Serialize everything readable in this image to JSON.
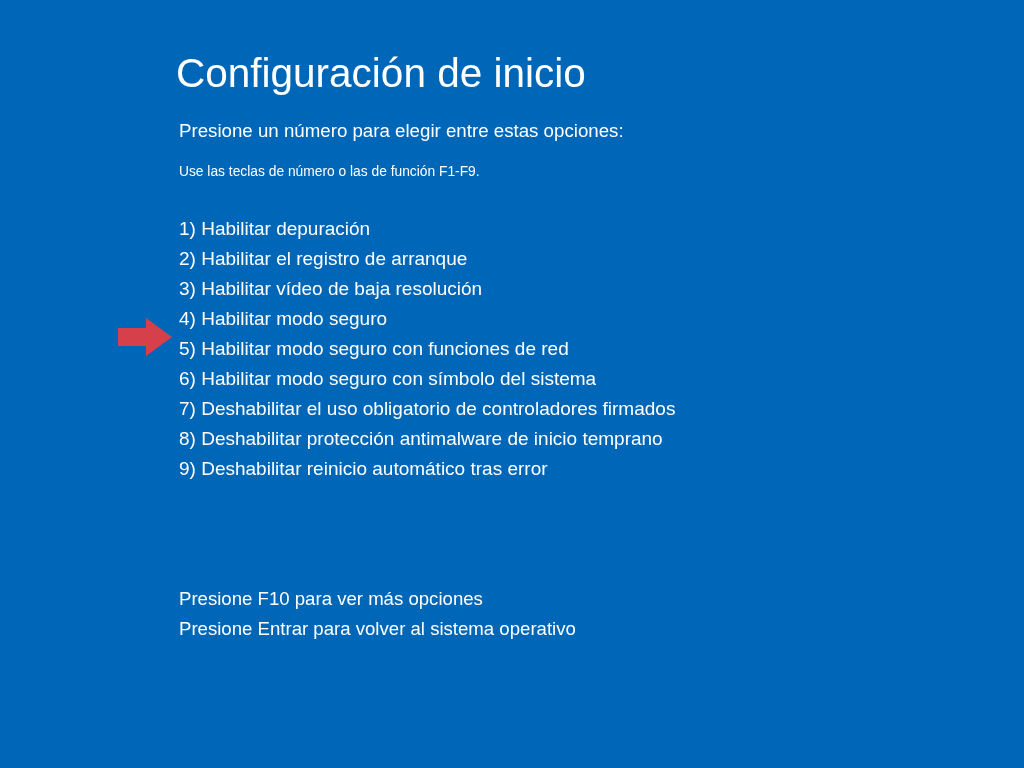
{
  "screen": {
    "title": "Configuración de inicio",
    "prompt": "Presione un número para elegir entre estas opciones:",
    "hint": "Use las teclas de número o las de función F1-F9.",
    "options": [
      {
        "label": "1) Habilitar depuración",
        "highlighted": false
      },
      {
        "label": "2) Habilitar el registro de arranque",
        "highlighted": false
      },
      {
        "label": "3) Habilitar vídeo de baja resolución",
        "highlighted": false
      },
      {
        "label": "4) Habilitar modo seguro",
        "highlighted": false
      },
      {
        "label": "5) Habilitar modo seguro con funciones de red",
        "highlighted": true
      },
      {
        "label": "6) Habilitar modo seguro con símbolo del sistema",
        "highlighted": false
      },
      {
        "label": "7) Deshabilitar el uso obligatorio de controladores firmados",
        "highlighted": false
      },
      {
        "label": "8) Deshabilitar protección antimalware de inicio temprano",
        "highlighted": false
      },
      {
        "label": "9) Deshabilitar reinicio automático tras error",
        "highlighted": false
      }
    ],
    "footer": [
      "Presione F10 para ver más opciones",
      "Presione Entrar para volver al sistema operativo"
    ]
  }
}
